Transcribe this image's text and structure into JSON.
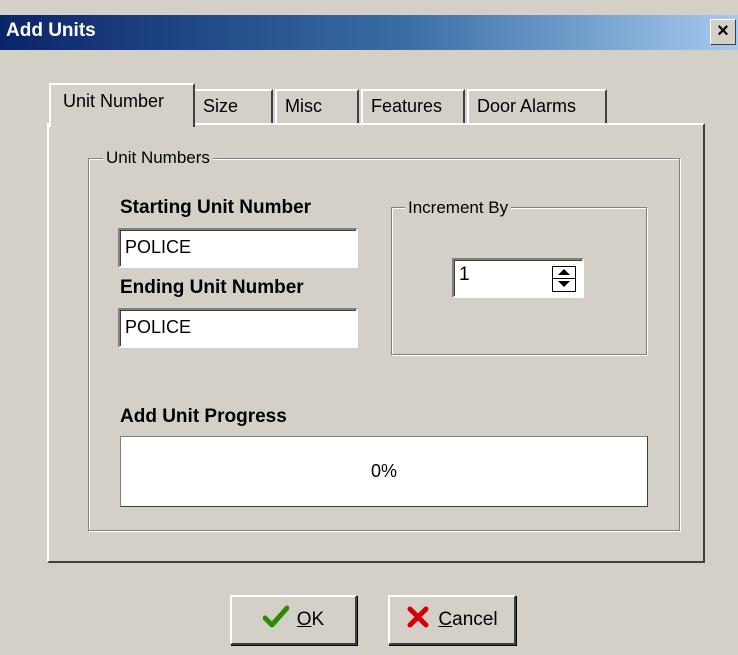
{
  "window": {
    "title": "Add Units",
    "close_glyph": "×"
  },
  "tabs": [
    {
      "label": "Unit Number",
      "active": true
    },
    {
      "label": "Size",
      "active": false
    },
    {
      "label": "Misc",
      "active": false
    },
    {
      "label": "Features",
      "active": false
    },
    {
      "label": "Door Alarms",
      "active": false
    }
  ],
  "unit_numbers": {
    "group_label": "Unit Numbers",
    "starting_label": "Starting Unit Number",
    "starting_value": "POLICE",
    "ending_label": "Ending Unit Number",
    "ending_value": "POLICE"
  },
  "increment": {
    "group_label": "Increment By",
    "value": "1"
  },
  "progress": {
    "label": "Add Unit Progress",
    "text": "0%",
    "fraction": 0
  },
  "buttons": {
    "ok": {
      "label": "OK",
      "mnemonic": "O",
      "rest": "K",
      "icon": "checkmark-icon",
      "icon_color": "#2e8b00"
    },
    "cancel": {
      "label": "Cancel",
      "mnemonic": "C",
      "rest": "ancel",
      "icon": "x-icon",
      "icon_color": "#d40000"
    }
  }
}
